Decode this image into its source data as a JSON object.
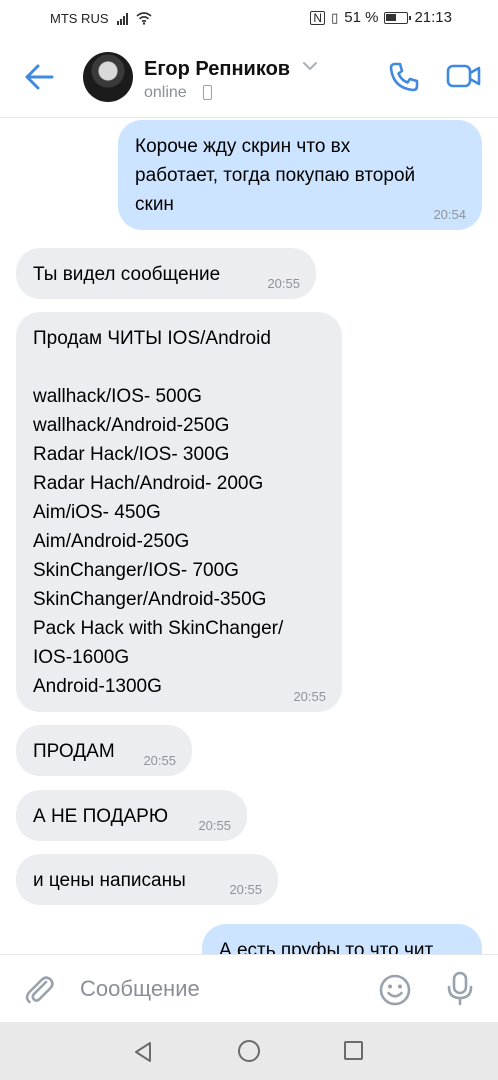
{
  "status_bar": {
    "carrier": "MTS RUS",
    "battery": "51 %",
    "time": "21:13"
  },
  "header": {
    "contact_name": "Егор Репников",
    "presence": "online"
  },
  "messages": [
    {
      "direction": "out",
      "text": "Короче жду скрин что вх\nработает, тогда покупаю второй\nскин",
      "time": "20:54"
    },
    {
      "direction": "in",
      "text": "Ты видел сообщение",
      "time": "20:55"
    },
    {
      "direction": "in",
      "text": "Продам ЧИТЫ IOS/Android\n\nwallhack/IOS- 500G\nwallhack/Android-250G\nRadar Hack/IOS- 300G\nRadar Hach/Android- 200G\nAim/iOS- 450G\nAim/Android-250G\nSkinChanger/IOS- 700G\nSkinChanger/Android-350G\nPack Hack with SkinChanger/\nIOS-1600G\nAndroid-1300G",
      "time": "20:55"
    },
    {
      "direction": "in",
      "text": "ПРОДАМ",
      "time": "20:55"
    },
    {
      "direction": "in",
      "text": "А НЕ ПОДАРЮ",
      "time": "20:55"
    },
    {
      "direction": "in",
      "text": "и цены написаны",
      "time": "20:55"
    },
    {
      "direction": "out",
      "text": "А есть пруфы то что чит",
      "time": ""
    }
  ],
  "composer": {
    "placeholder": "Сообщение"
  },
  "colors": {
    "accent": "#3f8ae0",
    "outgoing_bubble": "#cce4ff",
    "incoming_bubble": "#ebedf0"
  },
  "icons": [
    "back-arrow-icon",
    "chevron-down-icon",
    "phone-icon",
    "call-icon",
    "video-call-icon",
    "paperclip-icon",
    "smile-icon",
    "microphone-icon"
  ]
}
